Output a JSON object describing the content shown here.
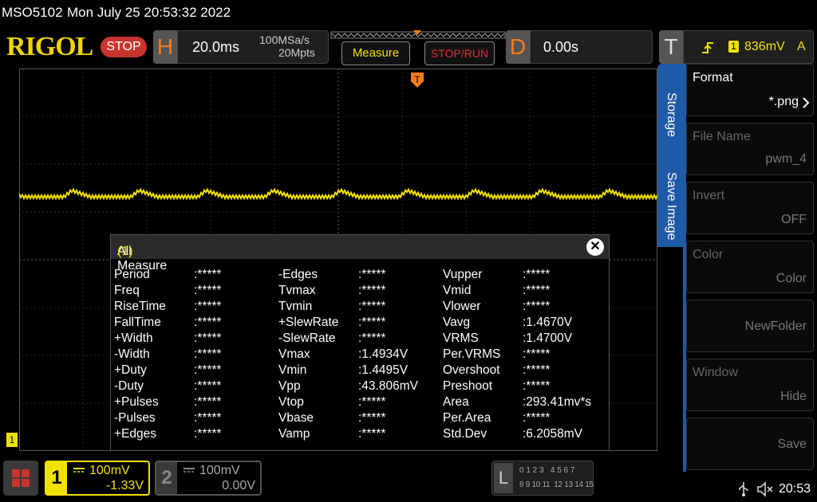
{
  "titlebar": {
    "model": "MSO5102",
    "datetime": "Mon July 25 20:53:32 2022"
  },
  "toolbar": {
    "brand": "RIGOL",
    "run_state": "STOP",
    "horizontal_key": "H",
    "timebase": "20.0ms",
    "sample_rate": "100MSa/s",
    "memory_depth": "20Mpts",
    "measure_label": "Measure",
    "stoprun_label": "STOP/RUN",
    "delay_key": "D",
    "delay_value": "0.00s",
    "trigger_key": "T",
    "trigger_channel": "1",
    "trigger_level": "836mV",
    "trigger_mode": "A"
  },
  "measure": {
    "title": "All Measure",
    "channel": "(1)",
    "columns": [
      [
        {
          "name": "Period",
          "value": ":*****"
        },
        {
          "name": "Freq",
          "value": ":*****"
        },
        {
          "name": "RiseTime",
          "value": ":*****"
        },
        {
          "name": "FallTime",
          "value": ":*****"
        },
        {
          "name": "+Width",
          "value": ":*****"
        },
        {
          "name": "-Width",
          "value": ":*****"
        },
        {
          "name": "+Duty",
          "value": ":*****"
        },
        {
          "name": "-Duty",
          "value": ":*****"
        },
        {
          "name": "+Pulses",
          "value": ":*****"
        },
        {
          "name": "-Pulses",
          "value": ":*****"
        },
        {
          "name": "+Edges",
          "value": ":*****"
        }
      ],
      [
        {
          "name": "-Edges",
          "value": ":*****"
        },
        {
          "name": "Tvmax",
          "value": ":*****"
        },
        {
          "name": "Tvmin",
          "value": ":*****"
        },
        {
          "name": "+SlewRate",
          "value": ":*****"
        },
        {
          "name": "-SlewRate",
          "value": ":*****"
        },
        {
          "name": "Vmax",
          "value": ":1.4934V"
        },
        {
          "name": "Vmin",
          "value": ":1.4495V"
        },
        {
          "name": "Vpp",
          "value": ":43.806mV"
        },
        {
          "name": "Vtop",
          "value": ":*****"
        },
        {
          "name": "Vbase",
          "value": ":*****"
        },
        {
          "name": "Vamp",
          "value": ":*****"
        }
      ],
      [
        {
          "name": "Vupper",
          "value": ":*****"
        },
        {
          "name": "Vmid",
          "value": ":*****"
        },
        {
          "name": "Vlower",
          "value": ":*****"
        },
        {
          "name": "Vavg",
          "value": ":1.4670V"
        },
        {
          "name": "VRMS",
          "value": ":1.4700V"
        },
        {
          "name": "Per.VRMS",
          "value": ":*****"
        },
        {
          "name": "Overshoot",
          "value": ":*****"
        },
        {
          "name": "Preshoot",
          "value": ":*****"
        },
        {
          "name": "Area",
          "value": ":293.41mv*s"
        },
        {
          "name": "Per.Area",
          "value": ":*****"
        },
        {
          "name": "Std.Dev",
          "value": ":6.2058mV"
        }
      ]
    ]
  },
  "side_tabs": {
    "storage": "Storage",
    "save_image": "Save Image"
  },
  "softmenu": [
    {
      "label": "Format",
      "value": "*.png"
    },
    {
      "label": "File Name",
      "value": "pwm_4"
    },
    {
      "label": "Invert",
      "value": "OFF"
    },
    {
      "label": "Color",
      "value": "Color"
    },
    {
      "label": "",
      "value": "NewFolder"
    },
    {
      "label": "Window",
      "value": "Hide"
    },
    {
      "label": "",
      "value": "Save"
    }
  ],
  "channels": {
    "ch1": {
      "number": "1",
      "scale": "100mV",
      "offset": "-1.33V",
      "marker": "1"
    },
    "ch2": {
      "number": "2",
      "scale": "100mV",
      "offset": "0.00V"
    }
  },
  "logic": {
    "key": "L",
    "row1": "0 1 2 3   4 5 6 7",
    "row2": "8 9 10 11  12 13 14 15"
  },
  "status": {
    "time": "20:53"
  },
  "colors": {
    "ch1": "#f2e000",
    "accent": "#ff7a1a",
    "stop": "#c8342e",
    "menu_blue": "#1f5aa8"
  }
}
